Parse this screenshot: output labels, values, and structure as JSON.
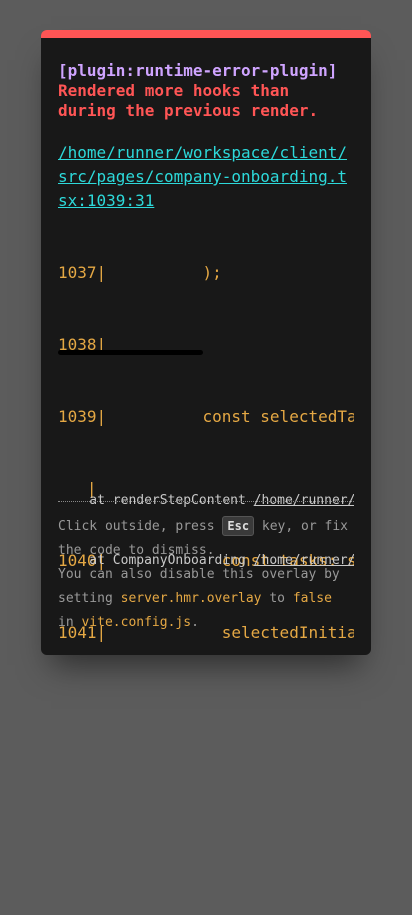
{
  "colors": {
    "backdrop": "#5c5c5c",
    "panel": "#181818",
    "accent_border": "#ff5555",
    "plugin_text": "#cfa4ff",
    "error_text": "#ff5555",
    "file_link": "#2dd9da",
    "code_frame": "#e5a844",
    "stack_text": "#c9c9c9",
    "tip_text": "#999999"
  },
  "error": {
    "plugin": "[plugin:runtime-error-plugin]",
    "message_lines": [
      "Rendered more hooks than",
      "during the previous render."
    ],
    "file_lines": [
      "/home/runner/workspace/client/",
      "src/pages/company-onboarding.t",
      "sx:1039:31"
    ]
  },
  "frame": {
    "lines": [
      "1037|          );",
      "1038|",
      "1039|          const selectedTa",
      "   |",
      "1040|            const tasks: s",
      "1041|            selectedInitia"
    ]
  },
  "stack": {
    "entries": [
      {
        "prefix": "    at renderStepContent ",
        "path": "/home/runner/"
      },
      {
        "prefix": "    at CompanyOnboarding ",
        "path": "/home/runner/"
      }
    ]
  },
  "tip": {
    "line1_before": "Click outside, press ",
    "key": "Esc",
    "line1_after": " key, or fix",
    "line2": "the code to dismiss.",
    "line3": "You can also disable this overlay by",
    "line4_prefix": "setting ",
    "setting_code": "server.hmr.overlay",
    "line4_mid": " to ",
    "value_code": "false",
    "line5_prefix": "in ",
    "config_code": "vite.config.js",
    "line5_suffix": "."
  }
}
